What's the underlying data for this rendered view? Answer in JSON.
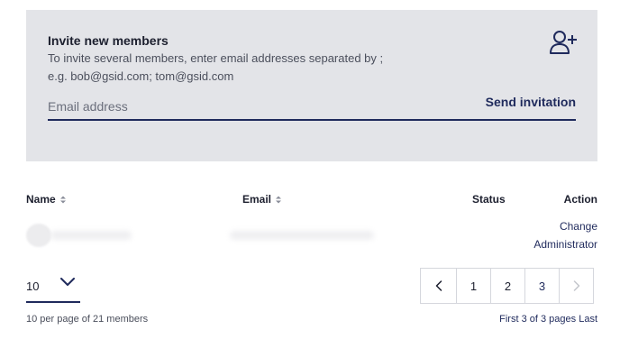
{
  "invite": {
    "title": "Invite new members",
    "help": "To invite several members, enter email addresses separated by ;",
    "example": "e.g. bob@gsid.com; tom@gsid.com",
    "email_placeholder": "Email address",
    "email_value": "",
    "send_label": "Send invitation",
    "icon": "add-user-icon"
  },
  "table": {
    "columns": {
      "name": "Name",
      "email": "Email",
      "status": "Status",
      "action": "Action"
    },
    "rows": [
      {
        "action_label": "Change Administrator"
      }
    ]
  },
  "pagination": {
    "per_page_value": "10",
    "summary": "10 per page of 21 members",
    "pages": [
      "1",
      "2",
      "3"
    ],
    "current_page": 3,
    "first_label": "First",
    "status": "3 of 3 pages",
    "last_label": "Last"
  },
  "colors": {
    "panel_bg": "#e3e4e8",
    "accent": "#1f2a5c",
    "text": "#1c1f2e"
  }
}
